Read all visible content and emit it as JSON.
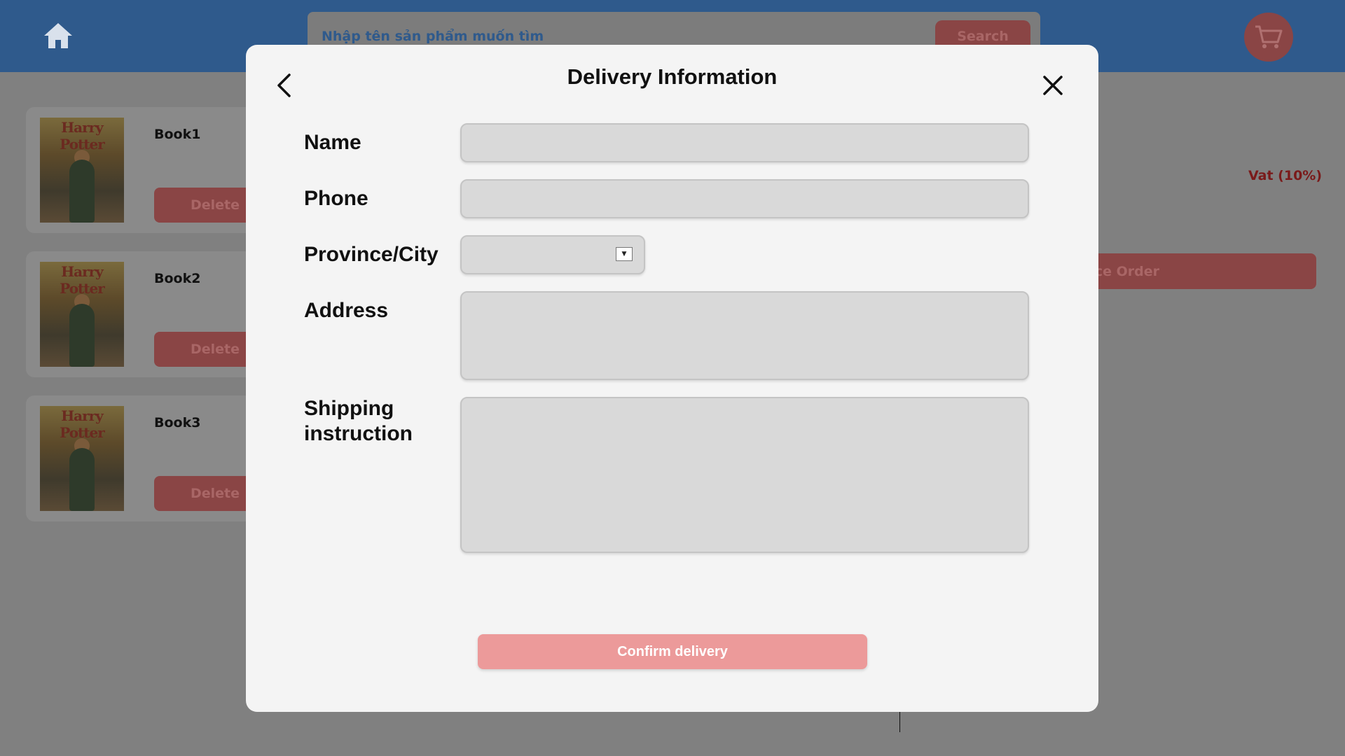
{
  "header": {
    "home_icon": "home-icon",
    "search": {
      "placeholder": "Nhập tên sản phẩm muốn tìm",
      "button_label": "Search"
    },
    "cart_icon": "cart-icon"
  },
  "cart": {
    "items": [
      {
        "name": "Book1",
        "cover_title": "Harry Potter",
        "delete_label": "Delete"
      },
      {
        "name": "Book2",
        "cover_title": "Harry Potter",
        "delete_label": "Delete"
      },
      {
        "name": "Book3",
        "cover_title": "Harry Potter",
        "delete_label": "Delete"
      }
    ],
    "vat_label": "Vat (10%)",
    "place_order_label": "ace Order"
  },
  "modal": {
    "title": "Delivery Information",
    "back_icon": "chevron-left-icon",
    "close_icon": "close-icon",
    "fields": {
      "name_label": "Name",
      "name_value": "",
      "phone_label": "Phone",
      "phone_value": "",
      "province_label": "Province/City",
      "province_value": "",
      "address_label": "Address",
      "address_value": "",
      "shipping_label_line1": "Shipping",
      "shipping_label_line2": "instruction",
      "shipping_value": ""
    },
    "confirm_label": "Confirm delivery"
  },
  "colors": {
    "header_bg": "#2f5a8c",
    "overlay_bg": "#808080",
    "modal_bg": "#f4f4f4",
    "field_bg": "#d9d9d9",
    "confirm_bg": "#ec9a9a",
    "accent_dimmed": "#8a4545",
    "vat_text": "#7a1a1a"
  }
}
